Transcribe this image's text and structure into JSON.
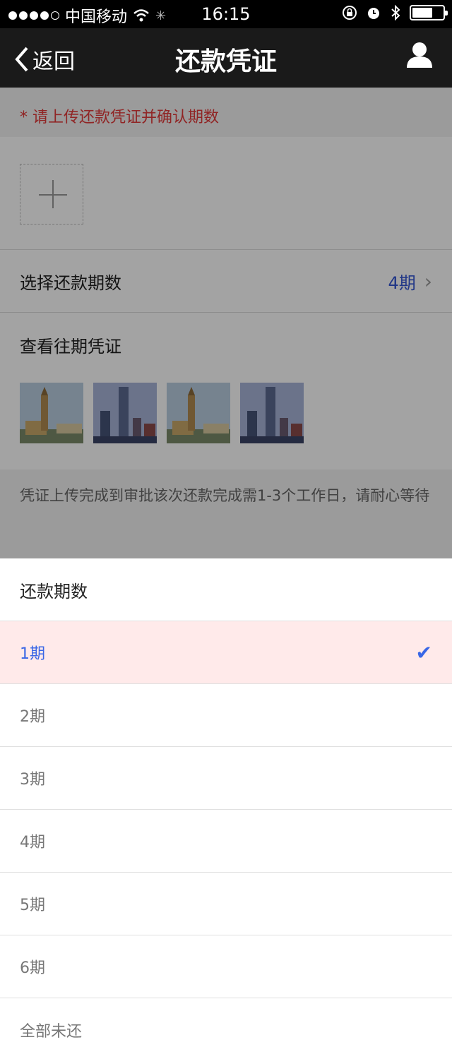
{
  "status_bar": {
    "carrier": "中国移动",
    "time": "16:15"
  },
  "nav": {
    "back_label": "返回",
    "title": "还款凭证"
  },
  "notice": "* 请上传还款凭证并确认期数",
  "select_row": {
    "label": "选择还款期数",
    "value": "4期"
  },
  "history": {
    "title": "查看往期凭证",
    "thumbnails": [
      "big-ben-photo",
      "skyline-photo",
      "big-ben-photo",
      "skyline-photo"
    ]
  },
  "tip": "凭证上传完成到审批该次还款完成需1-3个工作日，请耐心等待",
  "sheet": {
    "title": "还款期数",
    "options": [
      {
        "label": "1期",
        "selected": true
      },
      {
        "label": "2期",
        "selected": false
      },
      {
        "label": "3期",
        "selected": false
      },
      {
        "label": "4期",
        "selected": false
      },
      {
        "label": "5期",
        "selected": false
      },
      {
        "label": "6期",
        "selected": false
      },
      {
        "label": "全部未还",
        "selected": false
      }
    ]
  },
  "colors": {
    "accent": "#3a67e6",
    "warning": "#e23a3a",
    "selected_bg": "#ffeaea"
  }
}
